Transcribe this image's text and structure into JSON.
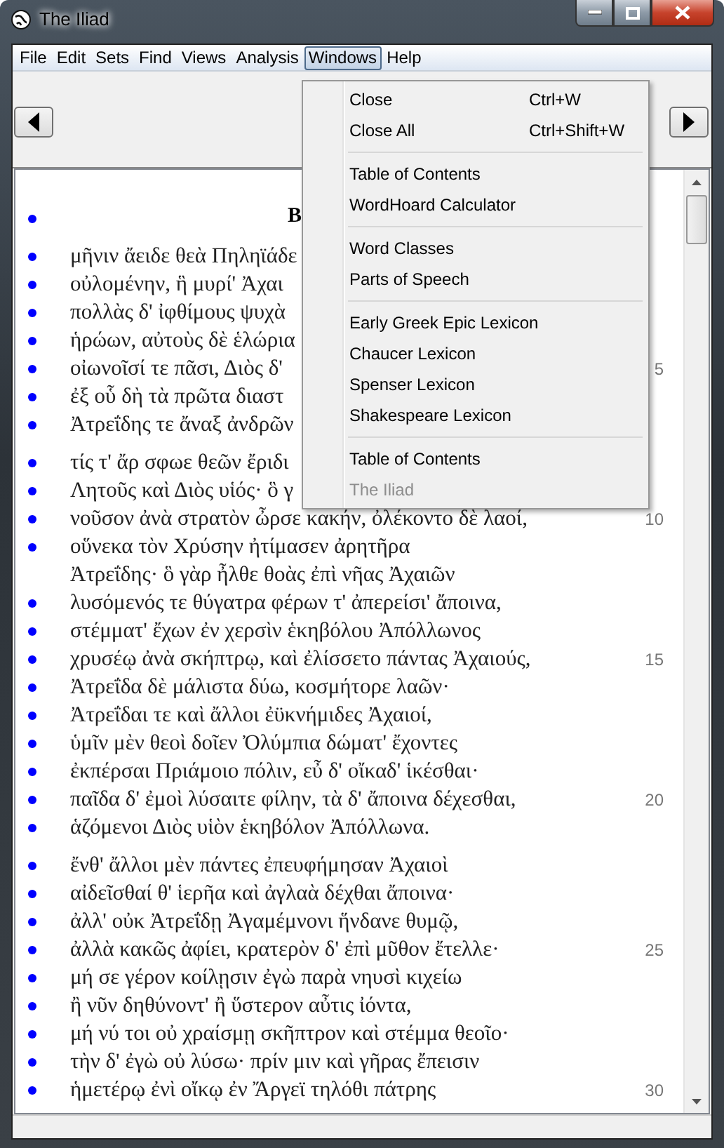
{
  "window": {
    "title": "The Iliad"
  },
  "menu_bar": [
    {
      "label": "File",
      "selected": false
    },
    {
      "label": "Edit",
      "selected": false
    },
    {
      "label": "Sets",
      "selected": false
    },
    {
      "label": "Find",
      "selected": false
    },
    {
      "label": "Views",
      "selected": false
    },
    {
      "label": "Analysis",
      "selected": false
    },
    {
      "label": "Windows",
      "selected": true
    },
    {
      "label": "Help",
      "selected": false
    }
  ],
  "windows_menu": {
    "groups": [
      [
        {
          "label": "Close",
          "shortcut": "Ctrl+W",
          "disabled": false
        },
        {
          "label": "Close All",
          "shortcut": "Ctrl+Shift+W",
          "disabled": false
        }
      ],
      [
        {
          "label": "Table of Contents",
          "disabled": false
        },
        {
          "label": "WordHoard Calculator",
          "disabled": false
        }
      ],
      [
        {
          "label": "Word Classes",
          "disabled": false
        },
        {
          "label": "Parts of Speech",
          "disabled": false
        }
      ],
      [
        {
          "label": "Early Greek Epic Lexicon",
          "disabled": false
        },
        {
          "label": "Chaucer Lexicon",
          "disabled": false
        },
        {
          "label": "Spenser Lexicon",
          "disabled": false
        },
        {
          "label": "Shakespeare Lexicon",
          "disabled": false
        }
      ],
      [
        {
          "label": "Table of Contents",
          "disabled": false
        },
        {
          "label": "The Iliad",
          "disabled": true
        }
      ]
    ]
  },
  "text": {
    "heading": {
      "text": "B",
      "bullet": true
    },
    "stanzas": [
      {
        "lines": [
          {
            "text": "μῆνιν ἄειδε θεὰ Πηληϊάδε",
            "bullet": true
          },
          {
            "text": "οὐλομένην, ἣ μυρί' Ἀχαι",
            "bullet": true
          },
          {
            "text": "πολλὰς δ' ἰφθίμους ψυχὰ",
            "bullet": true
          },
          {
            "text": "ἡρώων, αὐτοὺς δὲ ἑλώρια",
            "bullet": true
          },
          {
            "text": "οἰωνοῖσί τε πᾶσι, Διὸς δ'",
            "number": "5",
            "bullet": true
          },
          {
            "text": "ἐξ οὗ δὴ τὰ πρῶτα διαστ",
            "bullet": true
          },
          {
            "text": "Ἀτρεΐδης τε ἄναξ ἀνδρῶν",
            "bullet": true
          }
        ]
      },
      {
        "lines": [
          {
            "text": "τίς τ' ἄρ σφωε θεῶν ἔριδι",
            "bullet": true
          },
          {
            "text": "Λητοῦς καὶ Διὸς υἱός· ὃ γ",
            "bullet": true
          },
          {
            "text": "νοῦσον ἀνὰ στρατὸν ὦρσε κακήν, ὀλέκοντο δὲ λαοί,",
            "number": "10",
            "bullet": true
          },
          {
            "text": "οὕνεκα τὸν Χρύσην ἠτίμασεν ἀρητῆρα",
            "bullet": true
          },
          {
            "text": "Ἀτρεΐδης· ὃ γὰρ ἦλθε θοὰς ἐπὶ νῆας Ἀχαιῶν",
            "bullet": false
          },
          {
            "text": "λυσόμενός τε θύγατρα φέρων τ' ἀπερείσι' ἄποινα,",
            "bullet": true
          },
          {
            "text": "στέμματ' ἔχων ἐν χερσὶν ἑκηβόλου Ἀπόλλωνος",
            "bullet": true
          },
          {
            "text": "χρυσέῳ ἀνὰ σκήπτρῳ, καὶ ἐλίσσετο πάντας Ἀχαιούς,",
            "number": "15",
            "bullet": true
          },
          {
            "text": "Ἀτρεΐδα δὲ μάλιστα δύω, κοσμήτορε λαῶν·",
            "bullet": true
          },
          {
            "text": "Ἀτρεΐδαι τε καὶ ἄλλοι ἐϋκνήμιδες Ἀχαιοί,",
            "bullet": true
          },
          {
            "text": "ὑμῖν μὲν θεοὶ δοῖεν Ὀλύμπια δώματ' ἔχοντες",
            "bullet": true
          },
          {
            "text": "ἐκπέρσαι Πριάμοιο πόλιν, εὖ δ' οἴκαδ' ἱκέσθαι·",
            "bullet": true
          },
          {
            "text": "παῖδα δ' ἐμοὶ λύσαιτε φίλην, τὰ δ' ἄποινα δέχεσθαι,",
            "number": "20",
            "bullet": true
          },
          {
            "text": "ἁζόμενοι Διὸς υἱὸν ἑκηβόλον Ἀπόλλωνα.",
            "bullet": true
          }
        ]
      },
      {
        "lines": [
          {
            "text": "ἔνθ' ἄλλοι μὲν πάντες ἐπευφήμησαν Ἀχαιοὶ",
            "bullet": true
          },
          {
            "text": "αἰδεῖσθαί θ' ἱερῆα καὶ ἀγλαὰ δέχθαι ἄποινα·",
            "bullet": true
          },
          {
            "text": "ἀλλ' οὐκ Ἀτρεΐδῃ Ἀγαμέμνονι ἥνδανε θυμῷ,",
            "bullet": true
          },
          {
            "text": "ἀλλὰ κακῶς ἀφίει, κρατερὸν δ' ἐπὶ μῦθον ἔτελλε·",
            "number": "25",
            "bullet": true
          },
          {
            "text": "μή σε γέρον κοίλῃσιν ἐγὼ παρὰ νηυσὶ κιχείω",
            "bullet": true
          },
          {
            "text": "ἢ νῦν δηθύνοντ' ἢ ὕστερον αὖτις ἰόντα,",
            "bullet": true
          },
          {
            "text": "μή νύ τοι οὐ χραίσμῃ σκῆπτρον καὶ στέμμα θεοῖο·",
            "bullet": true
          },
          {
            "text": "τὴν δ' ἐγὼ οὐ λύσω· πρίν μιν καὶ γῆρας ἔπεισιν",
            "bullet": true
          },
          {
            "text": "ἡμετέρῳ ἐνὶ οἴκῳ ἐν Ἄργεϊ τηλόθι πάτρης",
            "number": "30",
            "bullet": true
          }
        ]
      }
    ]
  }
}
